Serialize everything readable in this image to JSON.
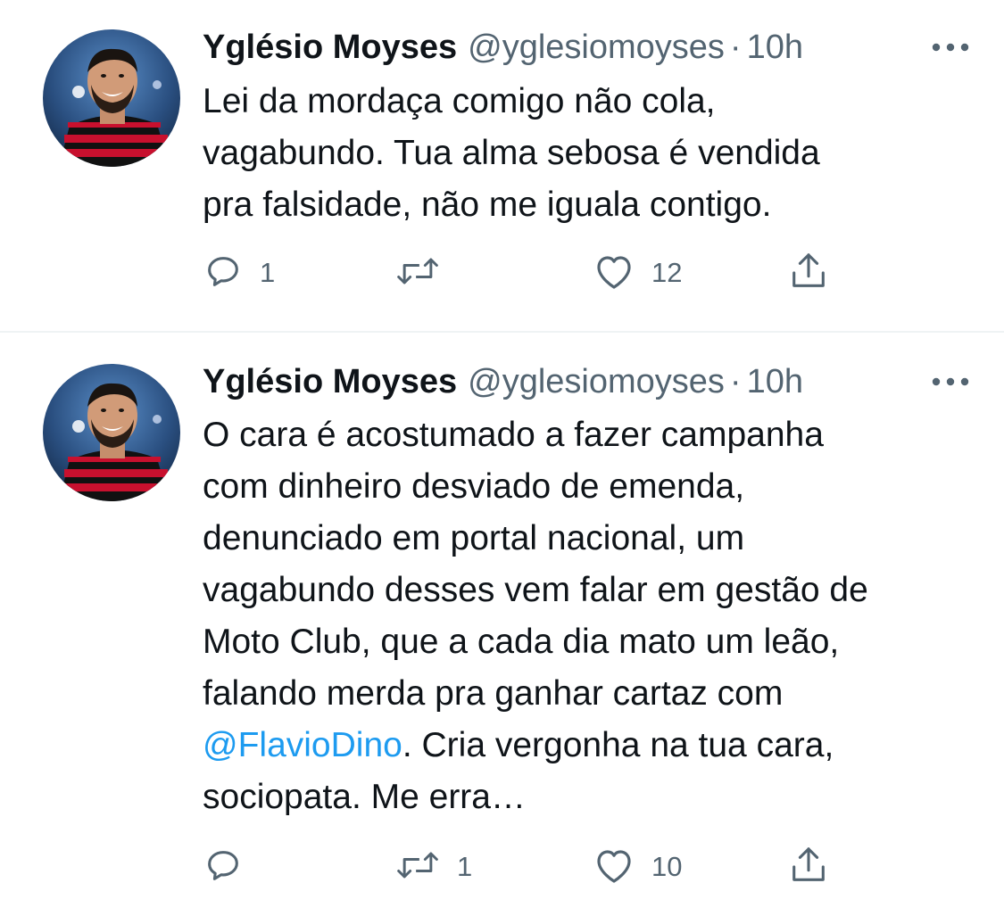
{
  "tweets": [
    {
      "author_name": "Yglésio Moyses",
      "author_handle": "@yglesiomoyses",
      "separator": "·",
      "time": "10h",
      "text_parts": {
        "line1": "Lei da mordaça comigo não cola,",
        "line2": "vagabundo. Tua alma sebosa é vendida",
        "line3": "pra falsidade, não me iguala contigo."
      },
      "reply_count": "1",
      "retweet_count": "",
      "like_count": "12",
      "icons": [
        "reply-icon",
        "retweet-icon",
        "like-icon",
        "share-icon",
        "more-icon"
      ]
    },
    {
      "author_name": "Yglésio Moyses",
      "author_handle": "@yglesiomoyses",
      "separator": "·",
      "time": "10h",
      "text_parts": {
        "line1": "O cara é acostumado a fazer campanha",
        "line2": "com dinheiro desviado de emenda,",
        "line3": "denunciado em portal nacional, um",
        "line4": "vagabundo desses vem falar em gestão de",
        "line5": "Moto Club, que a cada dia mato um leão,",
        "line6": "falando merda pra ganhar cartaz com",
        "mention": "@FlavioDino",
        "line7_rest": ". Cria vergonha na tua cara,",
        "line8": "sociopata. Me erra…"
      },
      "reply_count": "",
      "retweet_count": "1",
      "like_count": "10",
      "icons": [
        "reply-icon",
        "retweet-icon",
        "like-icon",
        "share-icon",
        "more-icon"
      ]
    }
  ],
  "colors": {
    "text_primary": "#0f1419",
    "text_secondary": "#536471",
    "link": "#1d9bf0",
    "divider": "#eff3f4",
    "jersey_red": "#c8102e",
    "jersey_black": "#111111"
  }
}
